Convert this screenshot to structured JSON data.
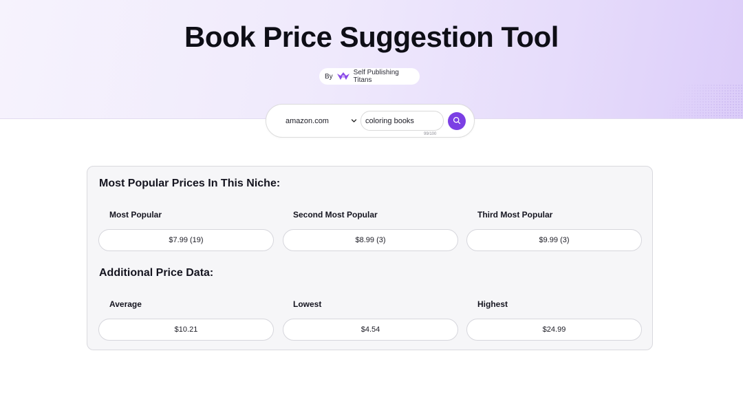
{
  "header": {
    "title": "Book Price Suggestion Tool",
    "by_label": "By",
    "brand_name": "Self Publishing Titans"
  },
  "search": {
    "marketplace": "amazon.com",
    "query": "coloring books",
    "char_counter": "99/100"
  },
  "popular": {
    "heading": "Most Popular Prices In This Niche:",
    "items": [
      {
        "label": "Most Popular",
        "value": "$7.99 (19)"
      },
      {
        "label": "Second Most Popular",
        "value": "$8.99 (3)"
      },
      {
        "label": "Third Most Popular",
        "value": "$9.99 (3)"
      }
    ]
  },
  "additional": {
    "heading": "Additional Price Data:",
    "items": [
      {
        "label": "Average",
        "value": "$10.21"
      },
      {
        "label": "Lowest",
        "value": "$4.54"
      },
      {
        "label": "Highest",
        "value": "$24.99"
      }
    ]
  },
  "colors": {
    "accent": "#7b3fe4",
    "hero_gradient_start": "#f6f3fd",
    "hero_gradient_end": "#dccdf9",
    "card_bg": "#f6f6f8"
  },
  "icons": {
    "brand": "titan-logo-icon",
    "select_arrow": "chevron-down-icon",
    "search": "search-icon"
  }
}
